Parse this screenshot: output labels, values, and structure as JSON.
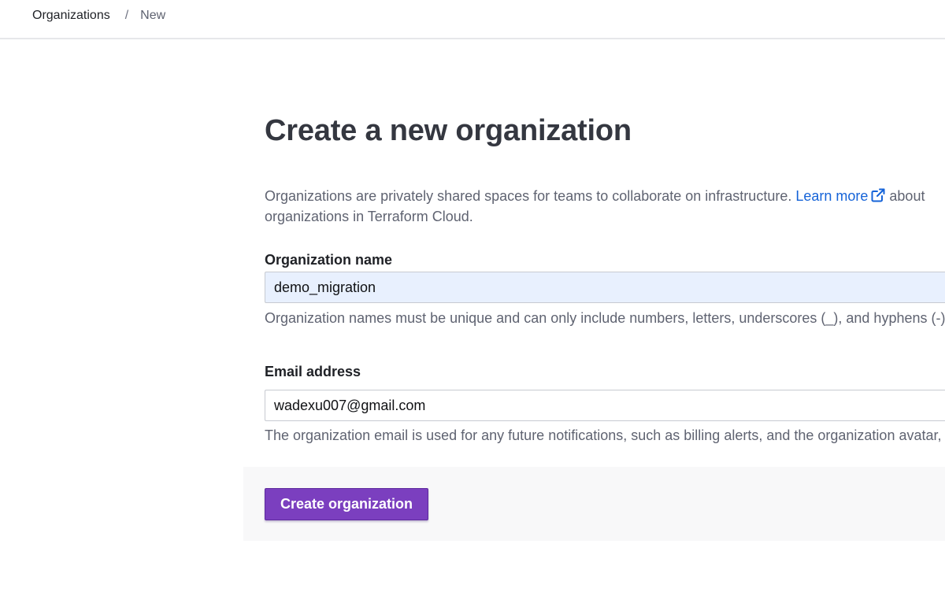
{
  "breadcrumb": {
    "parent": "Organizations",
    "separator": "/",
    "current": "New"
  },
  "page": {
    "title": "Create a new organization",
    "intro_text": "Organizations are privately shared spaces for teams to collaborate on infrastructure. ",
    "learn_more_label": "Learn more",
    "intro_tail": " about organizations in Terraform Cloud."
  },
  "form": {
    "org_name": {
      "label": "Organization name",
      "value": "demo_migration",
      "help": "Organization names must be unique and can only include numbers, letters, underscores (_), and hyphens (-)."
    },
    "email": {
      "label": "Email address",
      "value": "wadexu007@gmail.com",
      "help": "The organization email is used for any future notifications, such as billing alerts, and the organization avatar, via gravatar.com."
    },
    "submit_label": "Create organization"
  },
  "icons": {
    "external_link": "external-link-icon"
  },
  "colors": {
    "primary_button": "#7b3fbf",
    "link": "#1563d8",
    "autofill_bg": "#e8f0fe"
  }
}
